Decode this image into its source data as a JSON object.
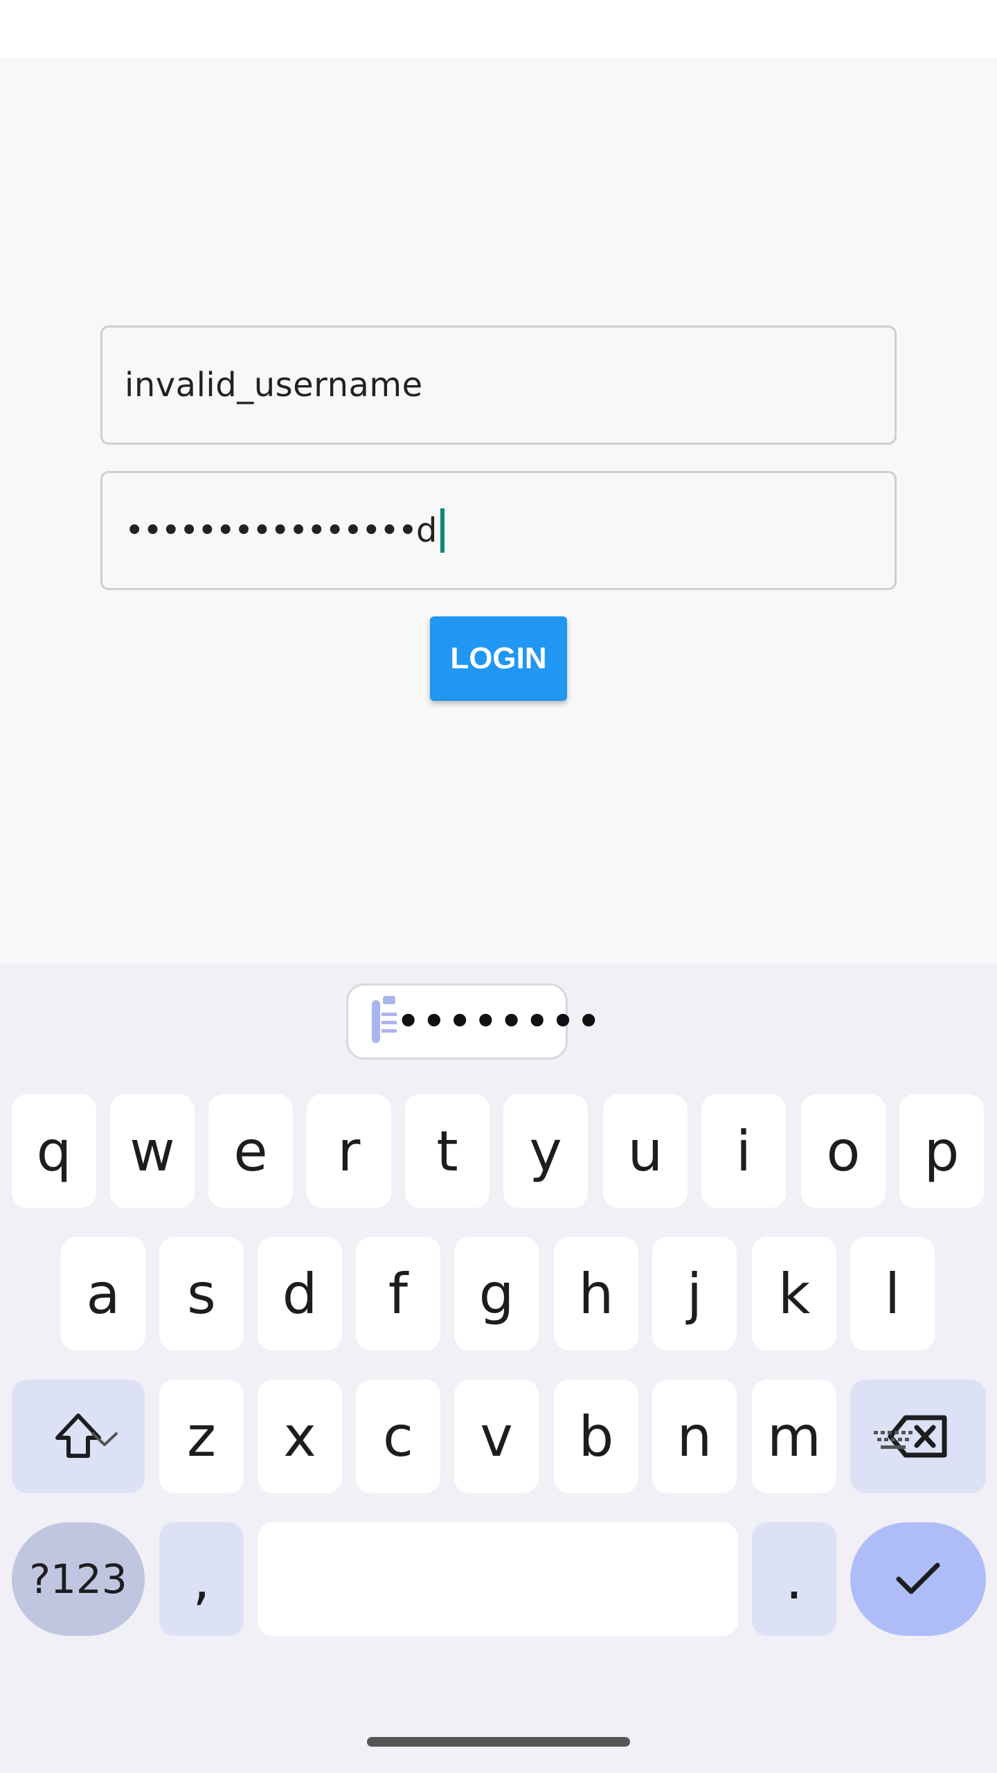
{
  "login_form": {
    "username_value": "invalid_username",
    "password_masked": "••••••••••••••••",
    "password_last_char": "d",
    "login_button_label": "LOGIN"
  },
  "keyboard": {
    "clipboard_suggestion": "••••••••",
    "row1": [
      "q",
      "w",
      "e",
      "r",
      "t",
      "y",
      "u",
      "i",
      "o",
      "p"
    ],
    "row2": [
      "a",
      "s",
      "d",
      "f",
      "g",
      "h",
      "j",
      "k",
      "l"
    ],
    "row3": [
      "z",
      "x",
      "c",
      "v",
      "b",
      "n",
      "m"
    ],
    "symbols_label": "?123",
    "comma_label": ",",
    "period_label": ".",
    "space_label": ""
  },
  "colors": {
    "accent": "#2196f3",
    "cursor": "#0a8a78",
    "keyboard_mod": "#dde1f6",
    "keyboard_enter": "#aebcf8"
  },
  "icons": {
    "shift": "shift-icon",
    "backspace": "backspace-icon",
    "enter": "check-icon",
    "clipboard": "clipboard-icon",
    "hide_keyboard": "chevron-down-icon",
    "switch_keyboard": "keyboard-icon"
  }
}
